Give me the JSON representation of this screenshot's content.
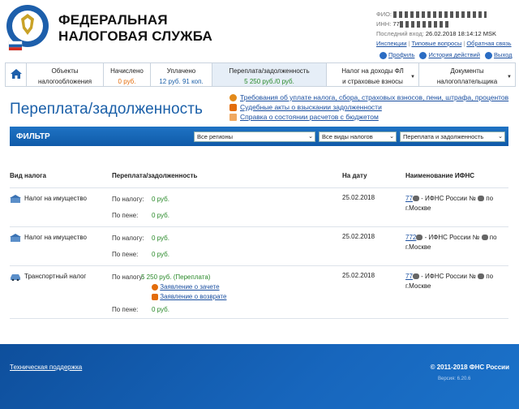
{
  "header": {
    "brand_line1": "ФЕДЕРАЛЬНАЯ",
    "brand_line2": "НАЛОГОВАЯ СЛУЖБА",
    "fio_label": "ФИО:",
    "inn_label": "ИНН:",
    "inn_prefix": "77",
    "last_login_label": "Последний вход:",
    "last_login_value": "26.02.2018 18:14:12 MSK",
    "links": [
      "Инспекции",
      "Типовые вопросы",
      "Обратная связь"
    ],
    "actions": [
      "Профиль",
      "История действий",
      "Выход"
    ]
  },
  "tabs": [
    {
      "label": "",
      "sub": "",
      "icon": "home-icon"
    },
    {
      "label": "Объекты",
      "sub": "налогообложения"
    },
    {
      "label": "Начислено",
      "sub": "0 руб."
    },
    {
      "label": "Уплачено",
      "sub": "12 руб. 91 коп."
    },
    {
      "label": "Переплата/задолженность",
      "sub": "5 250 руб./0 руб."
    },
    {
      "label": "Налог на доходы ФЛ",
      "sub": "и страховые взносы"
    },
    {
      "label": "Документы",
      "sub": "налогоплательщика"
    }
  ],
  "page_title": "Переплата/задолженность",
  "top_links": [
    "Требования об уплате налога, сбора, страховых взносов, пени, штрафа, процентов",
    "Судебные акты о взыскании задолженности",
    "Справка о состоянии расчетов с бюджетом"
  ],
  "filter": {
    "label": "ФИЛЬТР",
    "region": "Все регионы",
    "tax_type": "Все виды налогов",
    "status": "Переплата и задолженность"
  },
  "table": {
    "headers": [
      "Вид налога",
      "Переплата/задолженность",
      "На дату",
      "Наименование ИФНС"
    ],
    "rows": [
      {
        "tax": "Налог на имущество",
        "by_tax_label": "По налогу:",
        "by_tax_value": "0 руб.",
        "by_pen_label": "По пене:",
        "by_pen_value": "0 руб.",
        "date": "25.02.2018",
        "ifns_code": "77",
        "ifns_text": "- ИФНС России №",
        "ifns_suffix": "по",
        "ifns_city": "г.Москве"
      },
      {
        "tax": "Налог на имущество",
        "by_tax_label": "По налогу:",
        "by_tax_value": "0 руб.",
        "by_pen_label": "По пене:",
        "by_pen_value": "0 руб.",
        "date": "25.02.2018",
        "ifns_code": "772",
        "ifns_text": "- ИФНС России №",
        "ifns_suffix": "по",
        "ifns_city": "г.Москве"
      },
      {
        "tax": "Транспортный налог",
        "by_tax_label": "По налогу:",
        "by_tax_value": "5 250 руб. (Переплата)",
        "link1": "Заявление о зачете",
        "link2": "Заявление о возврате",
        "by_pen_label": "По пене:",
        "by_pen_value": "0 руб.",
        "date": "25.02.2018",
        "ifns_code": "77",
        "ifns_text": "- ИФНС России №",
        "ifns_suffix": "по",
        "ifns_city": "г.Москве"
      }
    ]
  },
  "footer": {
    "support": "Техническая поддержка",
    "copyright": "© 2011-2018 ФНС России",
    "version": "Версия: 6.20.6"
  },
  "colors": {
    "brand_blue": "#1a5fa8",
    "link": "#1a4fa0",
    "orange": "#e36c0a",
    "green": "#2a8a2a"
  }
}
